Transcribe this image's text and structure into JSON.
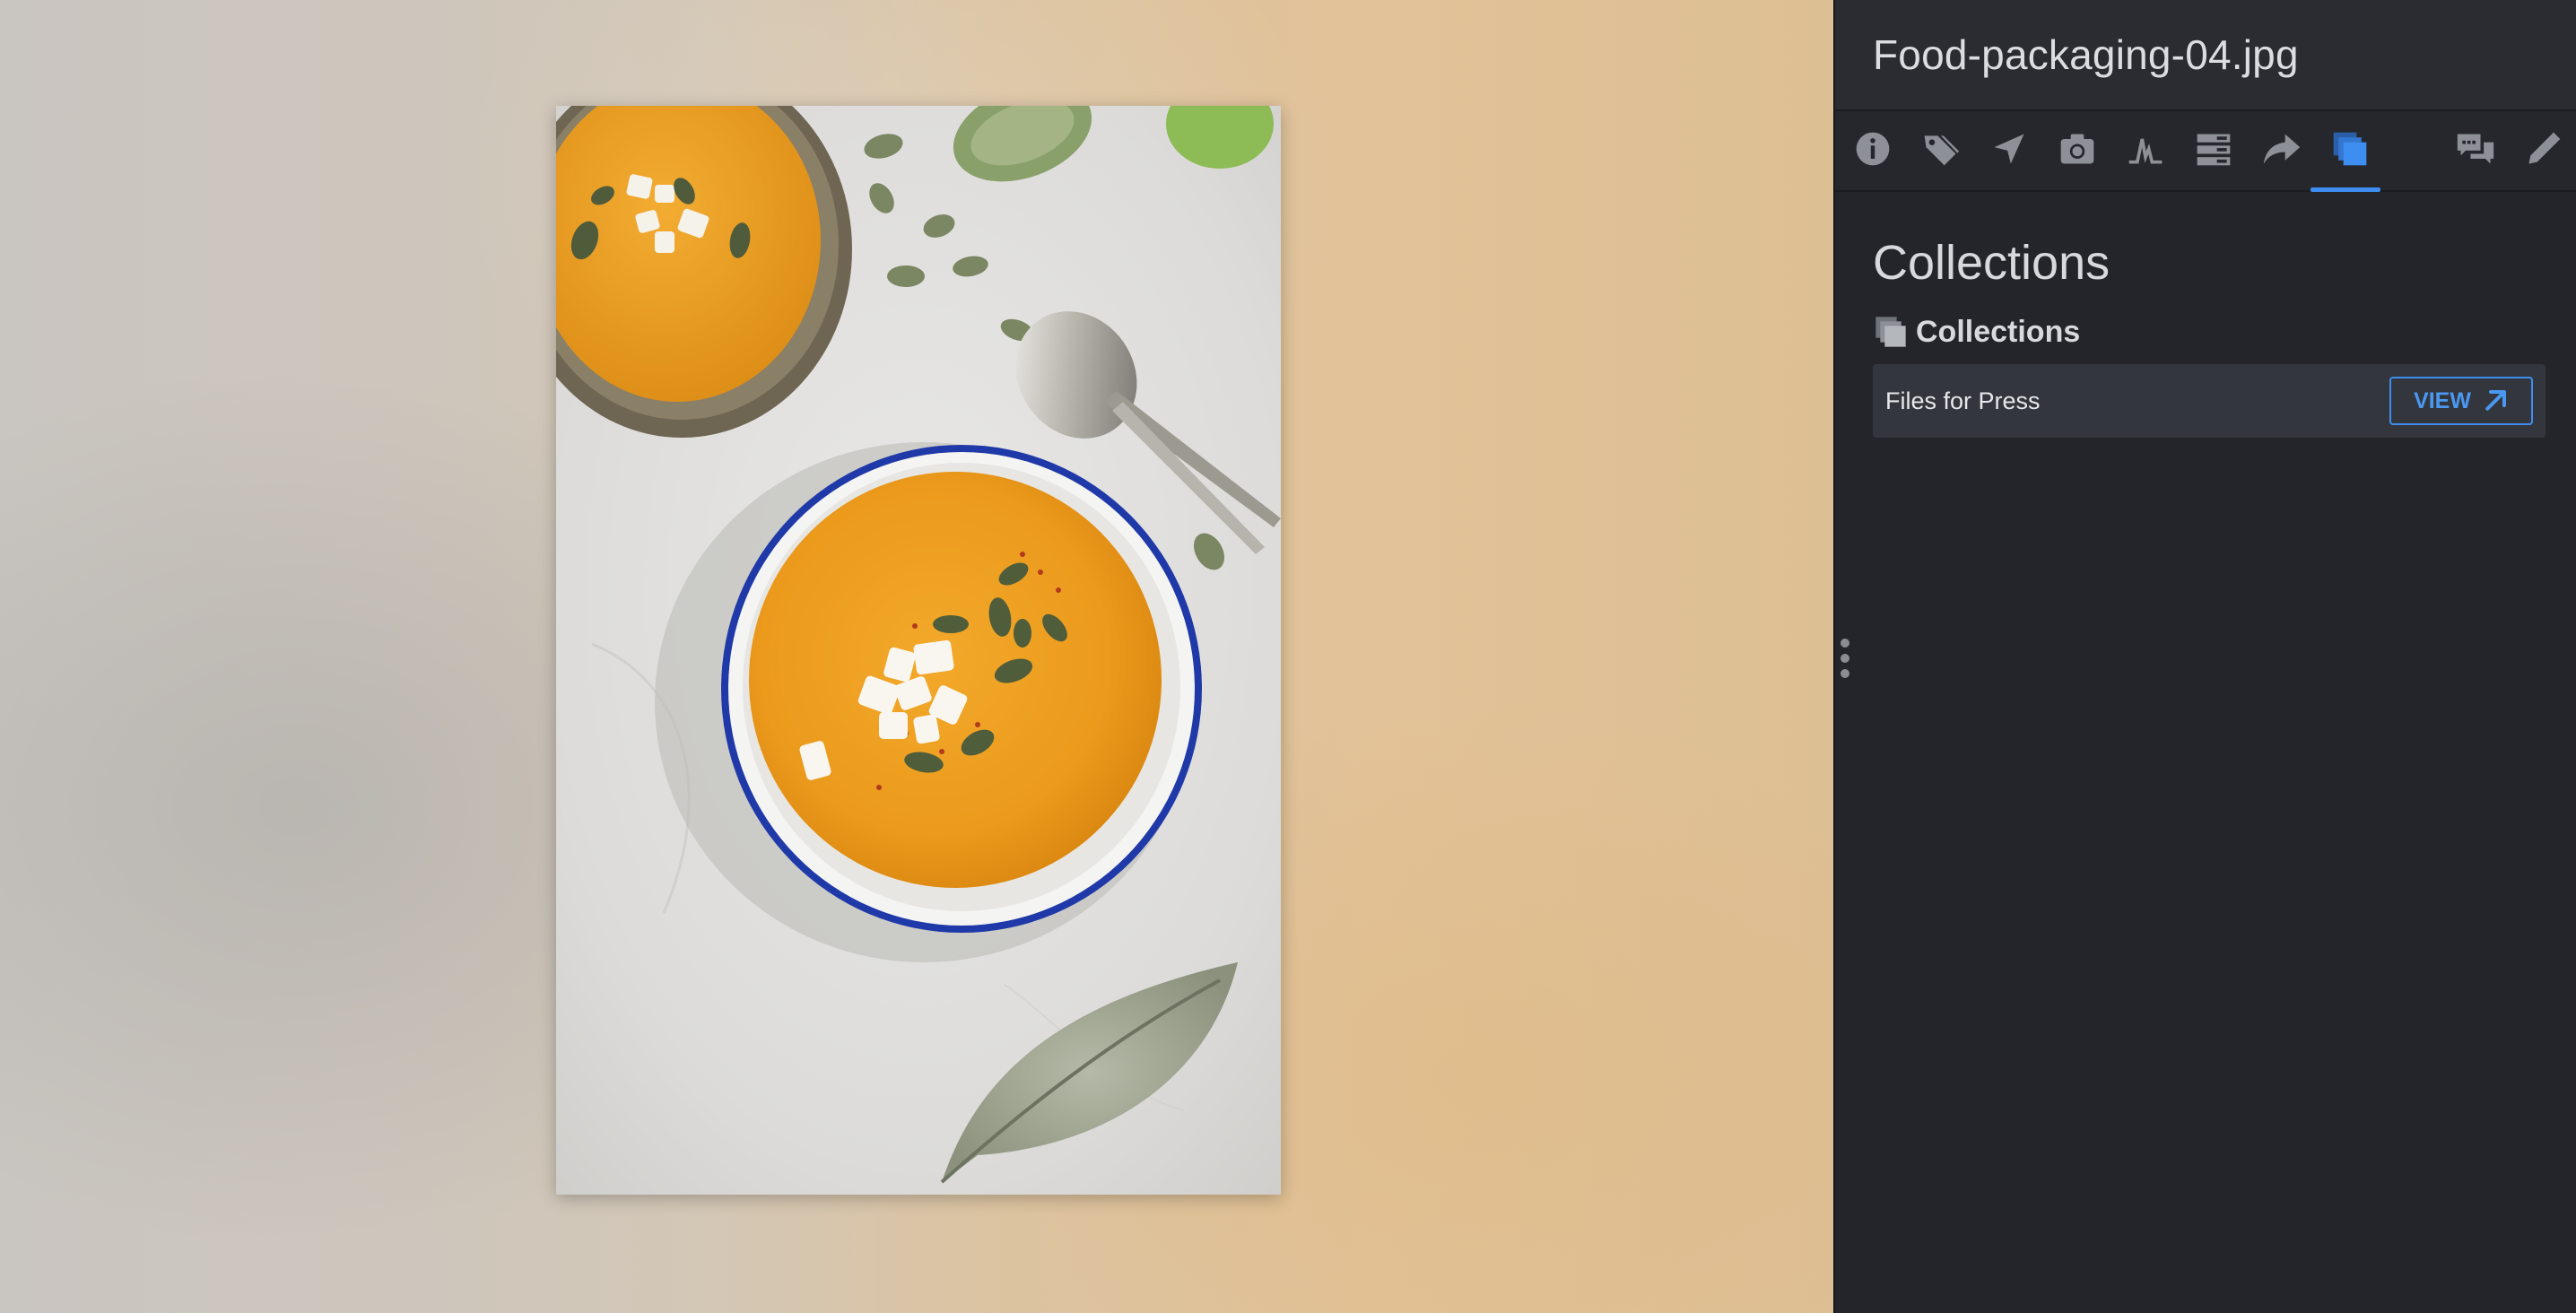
{
  "panel": {
    "file_title": "Food-packaging-04.jpg",
    "tabs": [
      {
        "icon": "info-icon"
      },
      {
        "icon": "tag-icon"
      },
      {
        "icon": "location-arrow-icon"
      },
      {
        "icon": "camera-icon"
      },
      {
        "icon": "histogram-icon"
      },
      {
        "icon": "metadata-icon"
      },
      {
        "icon": "share-icon"
      },
      {
        "icon": "collections-icon",
        "active": true
      },
      {
        "icon": "comments-icon"
      },
      {
        "icon": "pencil-icon"
      }
    ],
    "section_title": "Collections",
    "subheading": "Collections",
    "collections": [
      {
        "name": "Files for Press",
        "button_label": "VIEW"
      }
    ]
  },
  "colors": {
    "accent": "#3d8ef0",
    "panel_bg": "#23252a",
    "icon_default": "#8d9096"
  }
}
